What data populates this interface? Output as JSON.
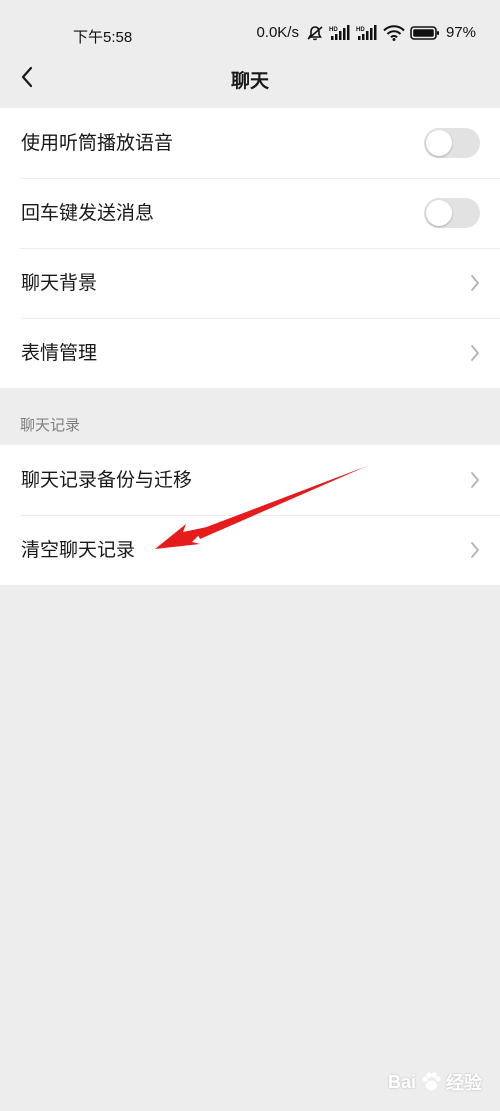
{
  "status_bar": {
    "time": "下午5:58",
    "network_speed": "0.0K/s",
    "sim1_badge": "HD",
    "sim2_badge": "HD",
    "battery": "97%"
  },
  "nav": {
    "title": "聊天"
  },
  "settings": {
    "items": [
      {
        "label": "使用听筒播放语音",
        "type": "toggle",
        "on": false
      },
      {
        "label": "回车键发送消息",
        "type": "toggle",
        "on": false
      },
      {
        "label": "聊天背景",
        "type": "link"
      },
      {
        "label": "表情管理",
        "type": "link"
      }
    ]
  },
  "history_section": {
    "header": "聊天记录",
    "items": [
      {
        "label": "聊天记录备份与迁移",
        "type": "link"
      },
      {
        "label": "清空聊天记录",
        "type": "link"
      }
    ]
  },
  "colors": {
    "background": "#ededed",
    "card": "#ffffff",
    "toggle_off": "#e2e2e2",
    "annotation_arrow": "#e61b1b"
  },
  "watermark": {
    "brand": "Bai",
    "text": "经验"
  }
}
